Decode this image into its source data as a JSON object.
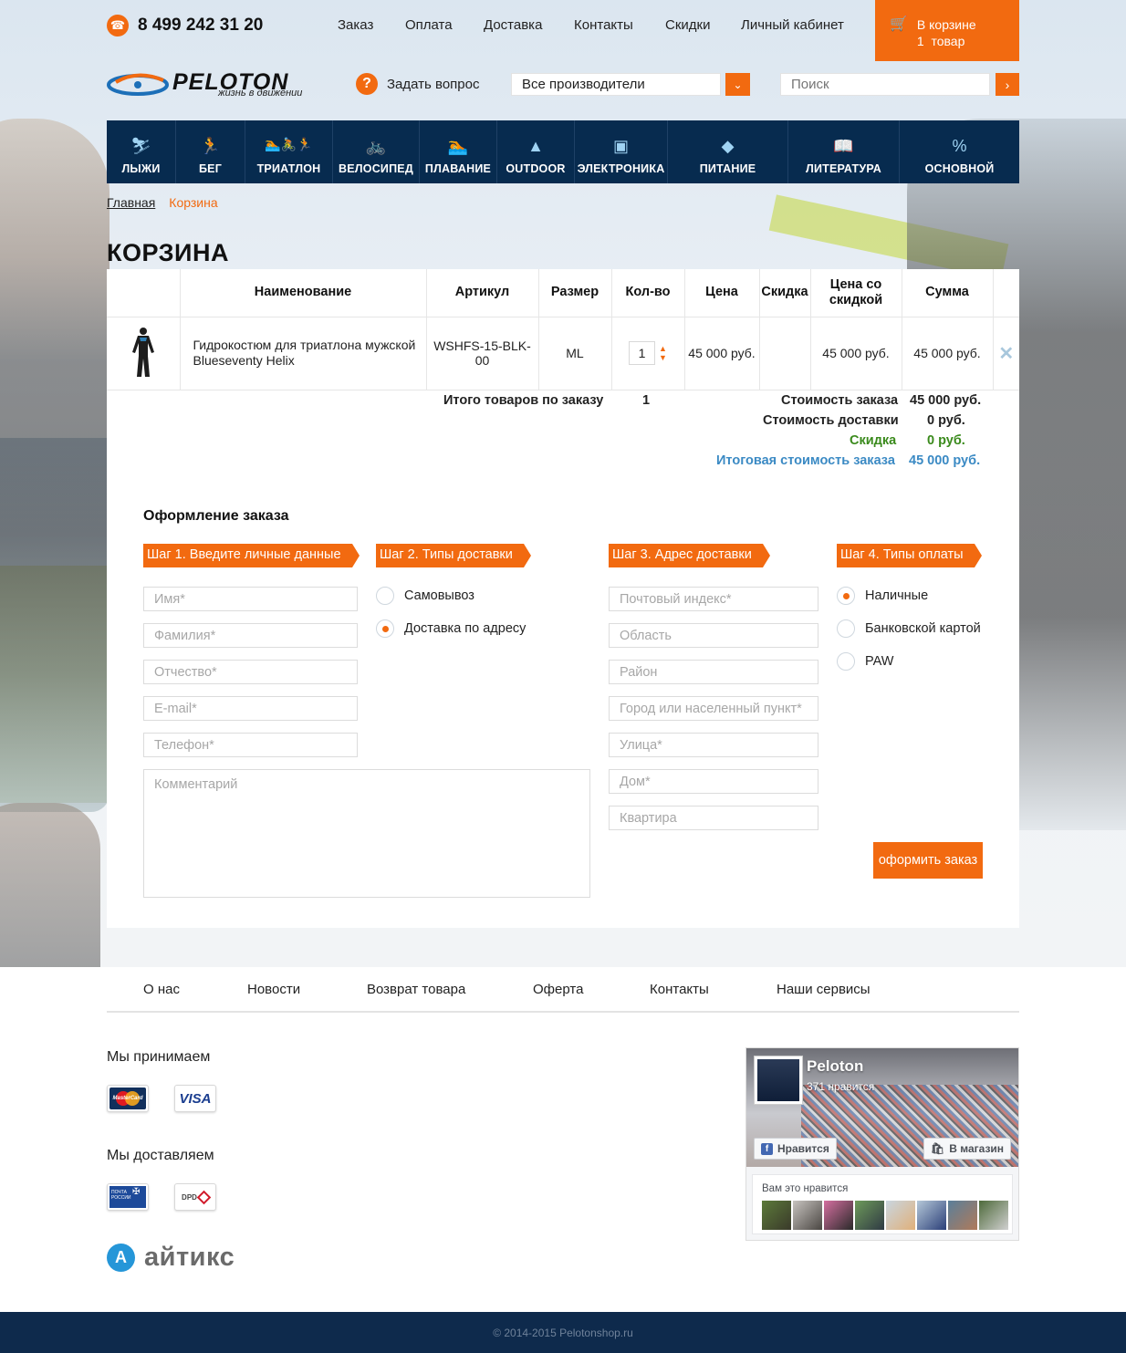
{
  "header": {
    "phone": "8 499 242 31 20",
    "nav": [
      "Заказ",
      "Оплата",
      "Доставка",
      "Контакты",
      "Скидки",
      "Личный кабинет"
    ],
    "cart": {
      "line1": "В корзине",
      "line2": "1  товар"
    },
    "logo": {
      "wordmark": "PELOTON",
      "tagline": "жизнь в движении"
    },
    "ask": "Задать вопрос",
    "brand_select": "Все производители",
    "search_placeholder": "Поиск",
    "icons": {
      "phone": "phone-icon",
      "cart": "cart-icon",
      "ask": "question-icon",
      "dropdown": "chevron-down-icon",
      "search": "chevron-right-icon"
    }
  },
  "categories": [
    {
      "label": "ЛЫЖИ",
      "icon": "skier-icon"
    },
    {
      "label": "БЕГ",
      "icon": "runner-icon"
    },
    {
      "label": "ТРИАТЛОН",
      "icon": "triathlon-icon"
    },
    {
      "label": "ВЕЛОСИПЕД",
      "icon": "bicycle-icon"
    },
    {
      "label": "ПЛАВАНИЕ",
      "icon": "swimmer-icon"
    },
    {
      "label": "OUTDOOR",
      "icon": "mountain-icon"
    },
    {
      "label": "ЭЛЕКТРОНИКА",
      "icon": "monitor-icon"
    },
    {
      "label": "ПИТАНИЕ",
      "icon": "nutrition-icon"
    },
    {
      "label": "ЛИТЕРАТУРА",
      "icon": "book-icon"
    },
    {
      "label": "ОСНОВНОЙ",
      "icon": "percent-icon"
    }
  ],
  "breadcrumb": {
    "home": "Главная",
    "current": "Корзина"
  },
  "page_title": "КОРЗИНА",
  "cart_table": {
    "headers": {
      "name": "Наименование",
      "sku": "Артикул",
      "size": "Размер",
      "qty": "Кол-во",
      "price": "Цена",
      "discount": "Скидка",
      "discounted_price": "Цена со скидкой",
      "sum": "Сумма"
    },
    "rows": [
      {
        "name": "Гидрокостюм для триатлона мужской Blueseventy Helix",
        "sku": "WSHFS-15-BLK-00",
        "size": "ML",
        "qty": "1",
        "price": "45 000 руб.",
        "discount": "",
        "discounted_price": "45 000 руб.",
        "sum": "45 000 руб."
      }
    ]
  },
  "totals": {
    "items_label": "Итого товаров по заказу",
    "items_value": "1",
    "order_cost_label": "Стоимость заказа",
    "order_cost_value": "45 000 руб.",
    "delivery_label": "Стоимость доставки",
    "delivery_value": "0 руб.",
    "discount_label": "Скидка",
    "discount_value": "0 руб.",
    "total_label": "Итоговая стоимость заказа",
    "total_value": "45 000 руб.",
    "colors": {
      "discount": "#3a8a1c",
      "total": "#3b8ac4"
    }
  },
  "checkout": {
    "title": "Оформление заказа",
    "steps": [
      "Шаг 1. Введите личные данные",
      "Шаг 2. Типы доставки",
      "Шаг 3. Адрес доставки",
      "Шаг 4. Типы оплаты"
    ],
    "personal_fields": [
      "Имя*",
      "Фамилия*",
      "Отчество*",
      "E-mail*",
      "Телефон*"
    ],
    "comment_placeholder": "Комментарий",
    "delivery_options": [
      {
        "label": "Самовывоз",
        "selected": false
      },
      {
        "label": "Доставка по адресу",
        "selected": true
      }
    ],
    "address_fields": [
      "Почтовый индекс*",
      "Область",
      "Район",
      "Город или населенный пункт*",
      "Улица*",
      "Дом*",
      "Квартира"
    ],
    "payment_options": [
      {
        "label": "Наличные",
        "selected": true
      },
      {
        "label": "Банковской картой",
        "selected": false
      },
      {
        "label": "PAW",
        "selected": false
      }
    ],
    "submit": "оформить заказ"
  },
  "footer": {
    "nav": [
      "О нас",
      "Новости",
      "Возврат товара",
      "Оферта",
      "Контакты",
      "Наши сервисы"
    ],
    "accept_title": "Мы принимаем",
    "accept": [
      "MasterCard",
      "VISA"
    ],
    "deliver_title": "Мы доставляем",
    "deliver": [
      "ПОЧТА РОССИИ",
      "DPD"
    ],
    "developer": "айтикс",
    "developer_badge": "A",
    "facebook": {
      "name": "Peloton",
      "likes": "371 нравится",
      "like_button": "Нравится",
      "shop_button": "В магазин",
      "friends_label": "Вам это нравится"
    },
    "copyright": "© 2014-2015 Pelotonshop.ru"
  },
  "accent_color": "#f26a10",
  "nav_color": "#072b4f"
}
